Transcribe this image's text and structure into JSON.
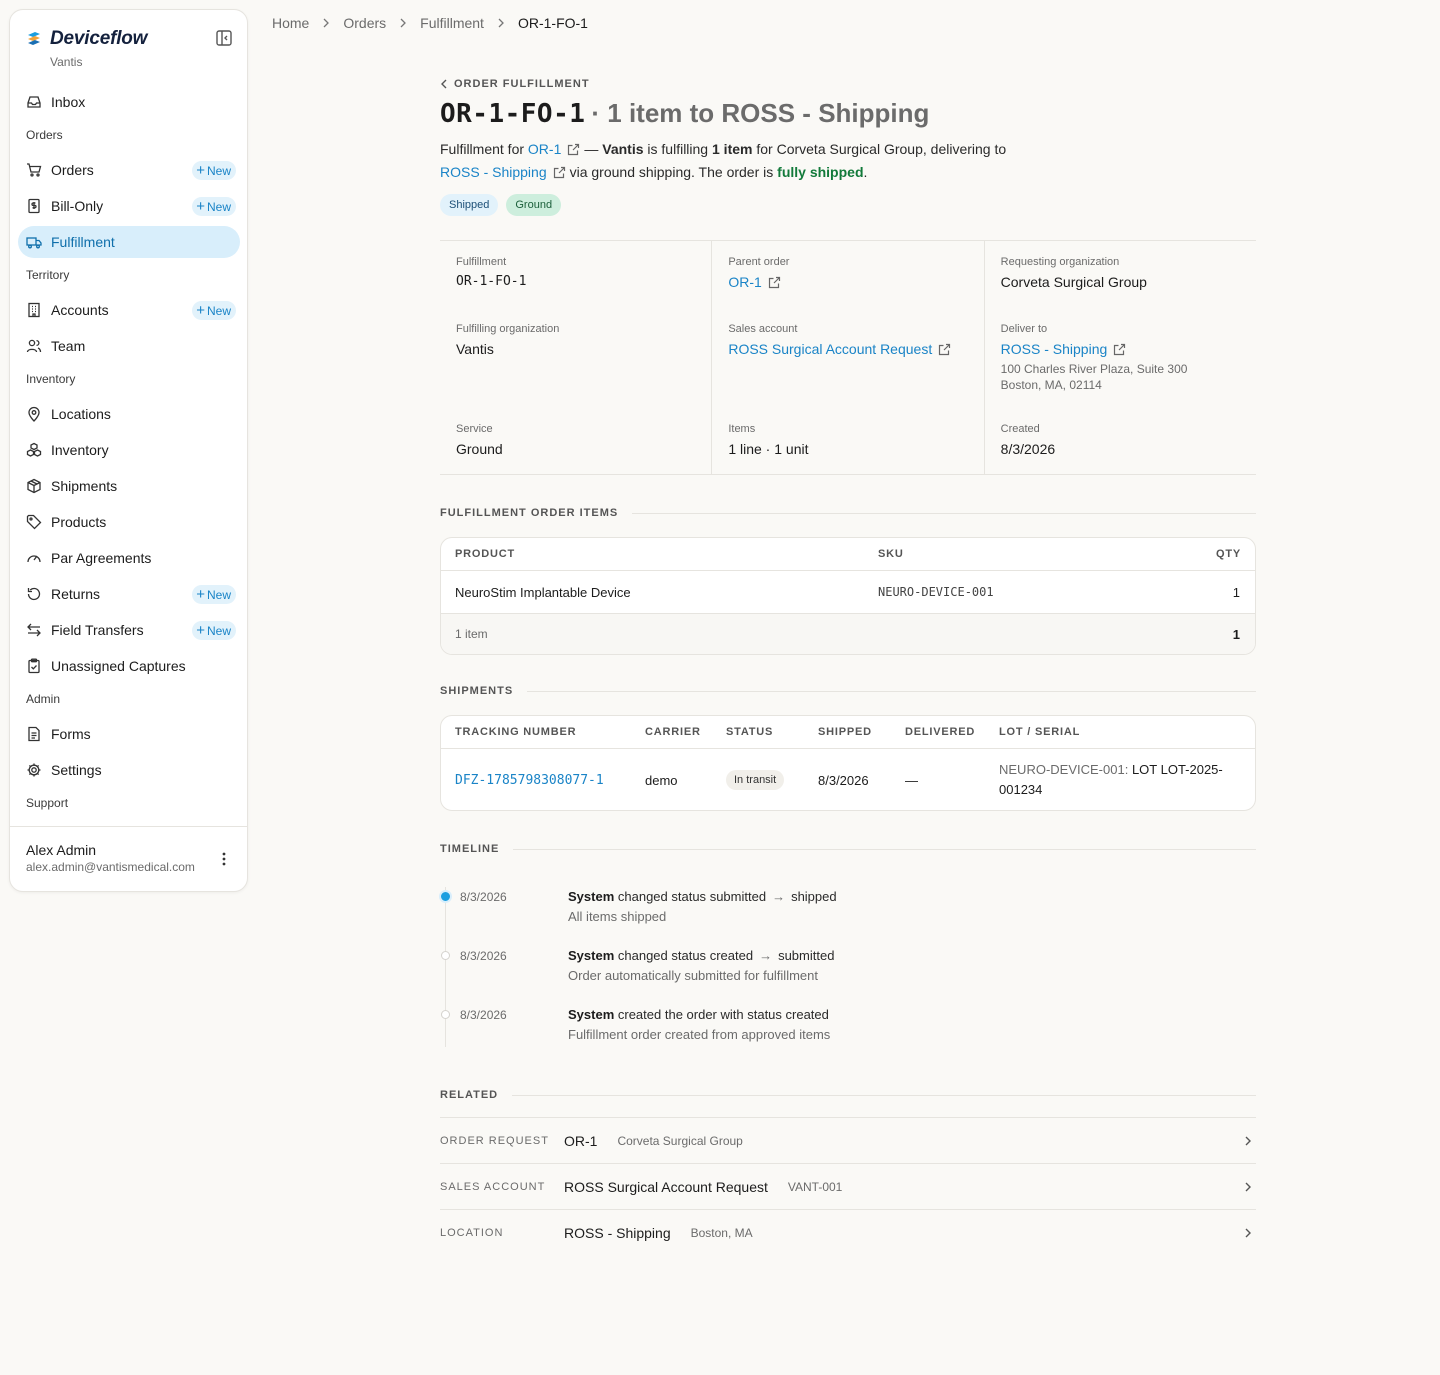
{
  "sidebar": {
    "brand": "Deviceflow",
    "org": "Vantis",
    "inbox": "Inbox",
    "sections": {
      "orders": "Orders",
      "territory": "Territory",
      "inventory": "Inventory",
      "admin": "Admin",
      "support": "Support"
    },
    "items": {
      "orders": "Orders",
      "bill_only": "Bill-Only",
      "fulfillment": "Fulfillment",
      "accounts": "Accounts",
      "team": "Team",
      "locations": "Locations",
      "inventory": "Inventory",
      "shipments": "Shipments",
      "products": "Products",
      "par_agreements": "Par Agreements",
      "returns": "Returns",
      "field_transfers": "Field Transfers",
      "unassigned_captures": "Unassigned Captures",
      "forms": "Forms",
      "settings": "Settings"
    },
    "new_label": "New",
    "user": {
      "name": "Alex Admin",
      "email": "alex.admin@vantismedical.com"
    }
  },
  "breadcrumb": [
    "Home",
    "Orders",
    "Fulfillment",
    "OR-1-FO-1"
  ],
  "header": {
    "back_label": "ORDER FULFILLMENT",
    "id": "OR-1-FO-1",
    "subtitle": "· 1 item to ROSS - Shipping",
    "desc": {
      "p1": "Fulfillment for",
      "order_link": "OR-1",
      "p2": "—",
      "org": "Vantis",
      "p3": "is fulfilling",
      "count": "1 item",
      "p4": "for Corveta Surgical Group, delivering to",
      "location_link": "ROSS - Shipping",
      "p5": "via ground shipping. The order is",
      "status": "fully shipped",
      "p6": "."
    },
    "pills": [
      "Shipped",
      "Ground"
    ]
  },
  "info": {
    "fulfillment_label": "Fulfillment",
    "fulfillment_value": "OR-1-FO-1",
    "parent_label": "Parent order",
    "parent_value": "OR-1",
    "requesting_label": "Requesting organization",
    "requesting_value": "Corveta Surgical Group",
    "fulfilling_label": "Fulfilling organization",
    "fulfilling_value": "Vantis",
    "sales_label": "Sales account",
    "sales_value": "ROSS Surgical Account Request",
    "deliver_label": "Deliver to",
    "deliver_value": "ROSS - Shipping",
    "deliver_addr1": "100 Charles River Plaza, Suite 300",
    "deliver_addr2": "Boston, MA, 02114",
    "service_label": "Service",
    "service_value": "Ground",
    "items_label": "Items",
    "items_value": "1 line · 1 unit",
    "created_label": "Created",
    "created_value": "8/3/2026"
  },
  "items_section": {
    "title": "FULFILLMENT ORDER ITEMS",
    "headers": {
      "product": "PRODUCT",
      "sku": "SKU",
      "qty": "QTY"
    },
    "rows": [
      {
        "product": "NeuroStim Implantable Device",
        "sku": "NEURO-DEVICE-001",
        "qty": "1"
      }
    ],
    "footer_label": "1 item",
    "footer_total": "1"
  },
  "shipments_section": {
    "title": "SHIPMENTS",
    "headers": {
      "tracking": "TRACKING NUMBER",
      "carrier": "CARRIER",
      "status": "STATUS",
      "shipped": "SHIPPED",
      "delivered": "DELIVERED",
      "lot": "LOT / SERIAL"
    },
    "rows": [
      {
        "tracking": "DFZ-1785798308077-1",
        "carrier": "demo",
        "status": "In transit",
        "shipped": "8/3/2026",
        "delivered": "—",
        "lot_prefix": "NEURO-DEVICE-001:",
        "lot_value": "LOT LOT-2025-001234"
      }
    ]
  },
  "timeline": {
    "title": "TIMELINE",
    "events": [
      {
        "date": "8/3/2026",
        "actor": "System",
        "verb": "changed status",
        "from": "submitted",
        "arrow": "→",
        "to": "shipped",
        "note": "All items shipped"
      },
      {
        "date": "8/3/2026",
        "actor": "System",
        "verb": "changed status",
        "from": "created",
        "arrow": "→",
        "to": "submitted",
        "note": "Order automatically submitted for fulfillment"
      },
      {
        "date": "8/3/2026",
        "actor": "System",
        "verb": "created the order with status created",
        "note": "Fulfillment order created from approved items"
      }
    ]
  },
  "related": {
    "title": "RELATED",
    "rows": [
      {
        "label": "ORDER REQUEST",
        "main": "OR-1",
        "sub": "Corveta Surgical Group"
      },
      {
        "label": "SALES ACCOUNT",
        "main": "ROSS Surgical Account Request",
        "sub": "VANT-001"
      },
      {
        "label": "LOCATION",
        "main": "ROSS - Shipping",
        "sub": "Boston, MA"
      }
    ]
  },
  "colors": {
    "accent": "#1a84c7",
    "active_bg": "#d8eefb",
    "success": "#127a3a"
  }
}
